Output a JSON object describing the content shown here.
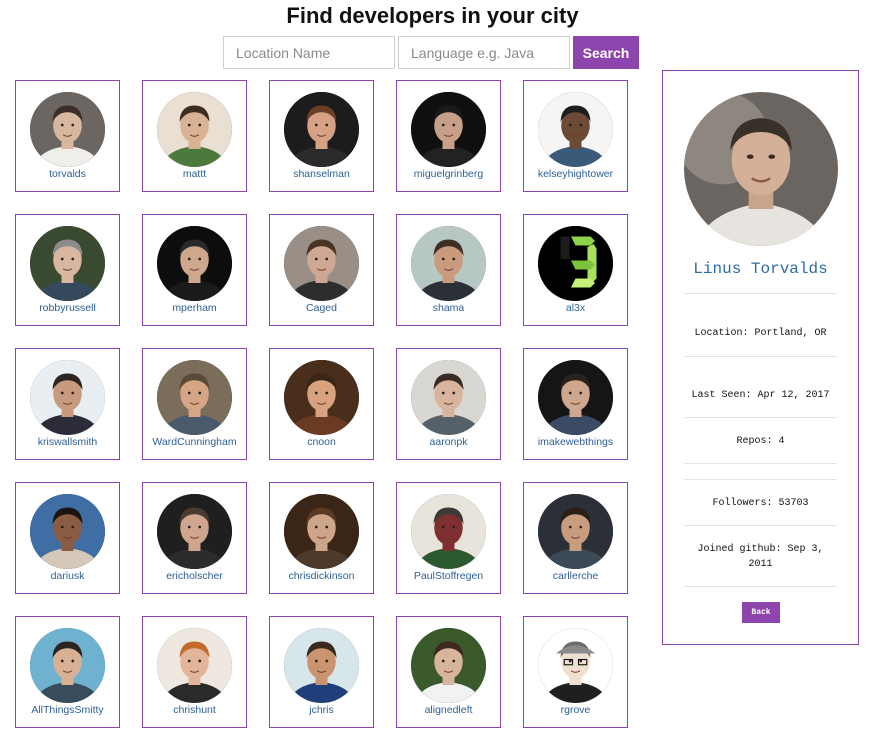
{
  "header": {
    "title": "Find developers in your city"
  },
  "search": {
    "location_placeholder": "Location Name",
    "location_value": "",
    "language_placeholder": "Language e.g. Java",
    "language_value": "",
    "button_label": "Search"
  },
  "developers": [
    {
      "username": "torvalds"
    },
    {
      "username": "mattt"
    },
    {
      "username": "shanselman"
    },
    {
      "username": "miguelgrinberg"
    },
    {
      "username": "kelseyhightower"
    },
    {
      "username": "robbyrussell"
    },
    {
      "username": "mperham"
    },
    {
      "username": "Caged"
    },
    {
      "username": "shama"
    },
    {
      "username": "al3x"
    },
    {
      "username": "kriswallsmith"
    },
    {
      "username": "WardCunningham"
    },
    {
      "username": "cnoon"
    },
    {
      "username": "aaronpk"
    },
    {
      "username": "imakewebthings"
    },
    {
      "username": "dariusk"
    },
    {
      "username": "ericholscher"
    },
    {
      "username": "chrisdickinson"
    },
    {
      "username": "PaulStoffregen"
    },
    {
      "username": "carllerche"
    },
    {
      "username": "AllThingsSmitty"
    },
    {
      "username": "chrishunt"
    },
    {
      "username": "jchris"
    },
    {
      "username": "alignedleft"
    },
    {
      "username": "rgrove"
    }
  ],
  "profile": {
    "name": "Linus Torvalds",
    "location": "Location: Portland, OR",
    "last_seen": "Last Seen: Apr 12, 2017",
    "repos": "Repos: 4",
    "followers": "Followers: 53703",
    "joined": "Joined github: Sep 3, 2011",
    "back_label": "Back"
  },
  "colors": {
    "accent": "#8e44ad",
    "link": "#2c5f97",
    "name": "#2f6aa8"
  }
}
